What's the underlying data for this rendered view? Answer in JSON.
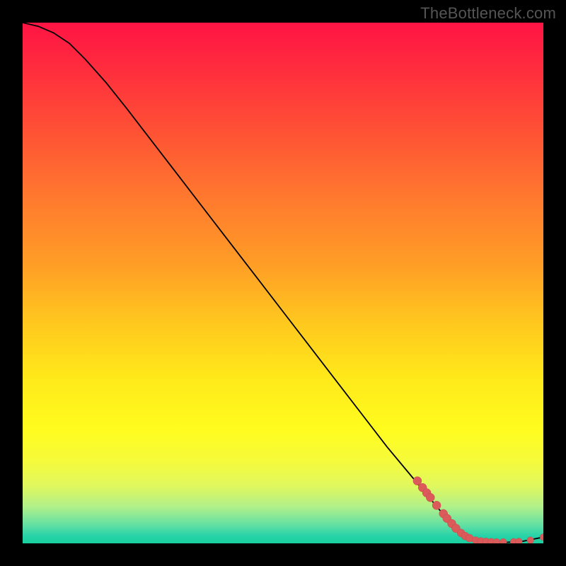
{
  "watermark_text": "TheBottleneck.com",
  "colors": {
    "background": "#000000",
    "curve": "#000000",
    "marker_fill": "#db5b5b",
    "marker_stroke": "#c64a4a",
    "gradient_stops": [
      "#ff1444",
      "#ff2a3e",
      "#ff5534",
      "#ff7a2e",
      "#ff9c26",
      "#ffc91e",
      "#ffe81a",
      "#fffc1e",
      "#f6fb3a",
      "#e0f85e",
      "#b0f08a",
      "#62e0a4",
      "#29d3a8",
      "#18cfa0"
    ]
  },
  "chart_data": {
    "type": "line",
    "title": "",
    "xlabel": "",
    "ylabel": "",
    "xlim": [
      0,
      100
    ],
    "ylim": [
      0,
      100
    ],
    "grid": false,
    "legend": false,
    "series": [
      {
        "name": "curve",
        "x": [
          0,
          3,
          6,
          9,
          12,
          16,
          20,
          25,
          30,
          35,
          40,
          45,
          50,
          55,
          60,
          65,
          70,
          75,
          80,
          84,
          86,
          88,
          90,
          93,
          96,
          100
        ],
        "y": [
          100,
          99.3,
          98.0,
          96.0,
          93.0,
          88.5,
          83.5,
          77.0,
          70.5,
          64.0,
          57.5,
          51.0,
          44.5,
          38.0,
          31.5,
          25.0,
          18.5,
          12.5,
          6.5,
          2.2,
          1.2,
          0.6,
          0.3,
          0.2,
          0.4,
          1.2
        ]
      }
    ],
    "markers": [
      {
        "x": 75.8,
        "y": 12.0,
        "r": 6.0
      },
      {
        "x": 76.8,
        "y": 10.7,
        "r": 6.0
      },
      {
        "x": 77.6,
        "y": 9.7,
        "r": 6.0
      },
      {
        "x": 78.3,
        "y": 8.8,
        "r": 6.0
      },
      {
        "x": 79.5,
        "y": 7.3,
        "r": 6.0
      },
      {
        "x": 80.8,
        "y": 5.7,
        "r": 6.0
      },
      {
        "x": 81.5,
        "y": 4.8,
        "r": 6.0
      },
      {
        "x": 82.4,
        "y": 3.8,
        "r": 6.0
      },
      {
        "x": 83.2,
        "y": 2.9,
        "r": 6.0
      },
      {
        "x": 84.2,
        "y": 2.0,
        "r": 5.5
      },
      {
        "x": 85.0,
        "y": 1.4,
        "r": 5.5
      },
      {
        "x": 85.8,
        "y": 1.0,
        "r": 5.5
      },
      {
        "x": 87.0,
        "y": 0.6,
        "r": 5.0
      },
      {
        "x": 88.0,
        "y": 0.45,
        "r": 5.0
      },
      {
        "x": 89.0,
        "y": 0.35,
        "r": 5.0
      },
      {
        "x": 90.0,
        "y": 0.3,
        "r": 5.0
      },
      {
        "x": 91.0,
        "y": 0.25,
        "r": 5.0
      },
      {
        "x": 92.3,
        "y": 0.25,
        "r": 5.0
      },
      {
        "x": 94.3,
        "y": 0.3,
        "r": 4.8
      },
      {
        "x": 95.3,
        "y": 0.35,
        "r": 4.8
      },
      {
        "x": 97.5,
        "y": 0.6,
        "r": 4.8
      },
      {
        "x": 100.0,
        "y": 1.2,
        "r": 4.8
      }
    ]
  }
}
